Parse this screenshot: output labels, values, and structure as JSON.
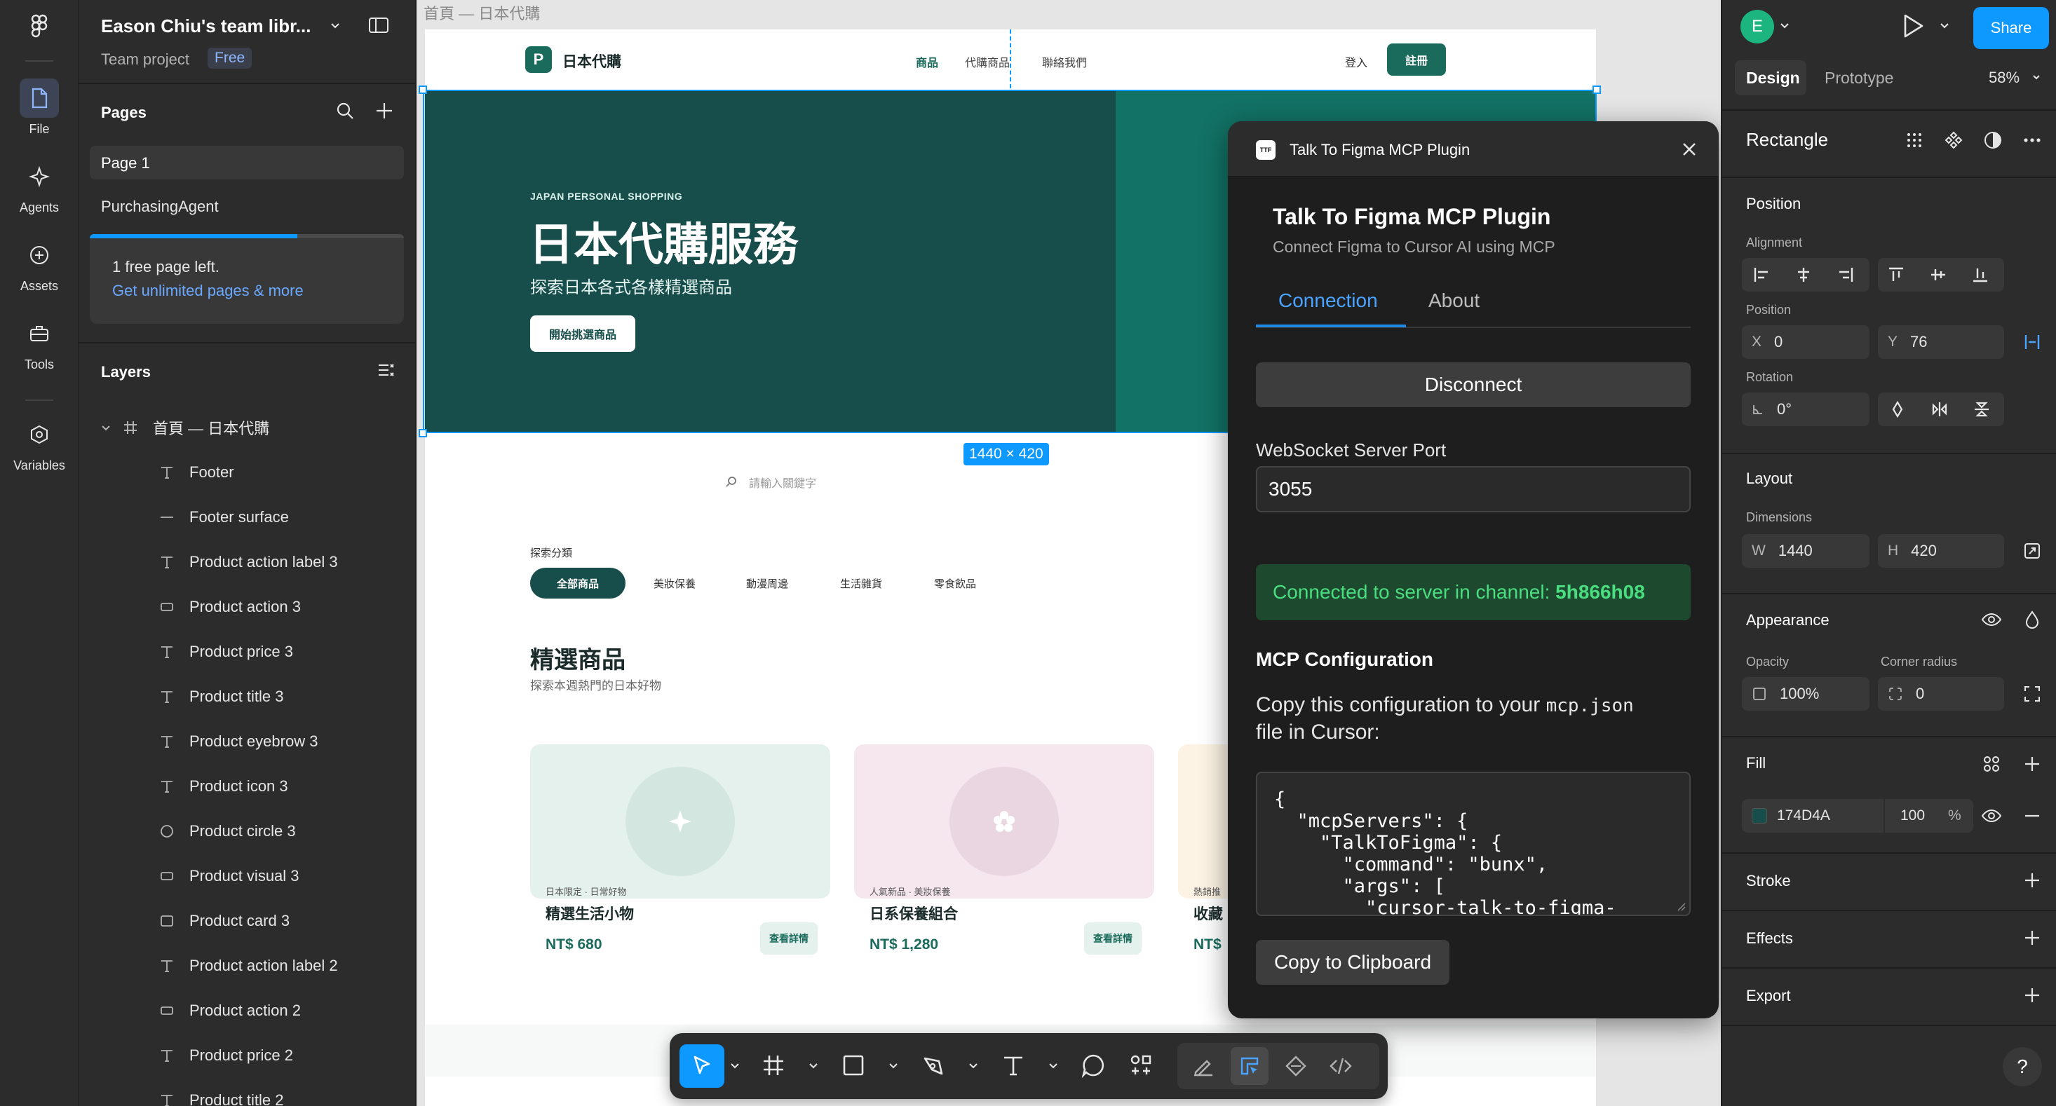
{
  "rail": {
    "items": [
      {
        "label": "File",
        "icon": "file-icon"
      },
      {
        "label": "Agents",
        "icon": "agents-sparkle-icon"
      },
      {
        "label": "Assets",
        "icon": "assets-plus-icon"
      },
      {
        "label": "Tools",
        "icon": "toolbox-icon"
      },
      {
        "label": "Variables",
        "icon": "variables-icon"
      }
    ]
  },
  "left_panel": {
    "team_name": "Eason Chiu's team libr...",
    "project_label": "Team project",
    "plan_badge": "Free",
    "pages_heading": "Pages",
    "pages": [
      "Page 1",
      "PurchasingAgent"
    ],
    "free_notice": "1 free page left.",
    "upgrade_link": "Get unlimited pages & more",
    "page_usage_fraction": 0.66,
    "layers_heading": "Layers",
    "root_frame": "首頁 — 日本代購",
    "layers": [
      {
        "name": "Footer",
        "type": "text"
      },
      {
        "name": "Footer surface",
        "type": "line"
      },
      {
        "name": "Product action label 3",
        "type": "text"
      },
      {
        "name": "Product action 3",
        "type": "rect"
      },
      {
        "name": "Product price 3",
        "type": "text"
      },
      {
        "name": "Product title 3",
        "type": "text"
      },
      {
        "name": "Product eyebrow 3",
        "type": "text"
      },
      {
        "name": "Product icon 3",
        "type": "text"
      },
      {
        "name": "Product circle 3",
        "type": "ellipse"
      },
      {
        "name": "Product visual 3",
        "type": "rect"
      },
      {
        "name": "Product card 3",
        "type": "frame"
      },
      {
        "name": "Product action label 2",
        "type": "text"
      },
      {
        "name": "Product action 2",
        "type": "rect"
      },
      {
        "name": "Product price 2",
        "type": "text"
      },
      {
        "name": "Product title 2",
        "type": "text"
      }
    ]
  },
  "canvas": {
    "frame_label": "首頁 — 日本代購",
    "selection_size": "1440 × 420",
    "site": {
      "logo_letter": "P",
      "brand": "日本代購",
      "nav": [
        "商品",
        "代購商品",
        "聯絡我們"
      ],
      "login": "登入",
      "signup": "註冊",
      "hero_eyebrow": "JAPAN PERSONAL SHOPPING",
      "hero_title": "日本代購服務",
      "hero_subtitle": "探索日本各式各樣精選商品",
      "hero_cta": "開始挑選商品",
      "search_placeholder": "請輸入關鍵字",
      "category_heading": "探索分類",
      "categories": [
        "全部商品",
        "美妝保養",
        "動漫周邊",
        "生活雜貨",
        "零食飲品"
      ],
      "featured_title": "精選商品",
      "featured_subtitle": "探索本週熱門的日本好物",
      "products": [
        {
          "eyebrow": "日本限定 · 日常好物",
          "title": "精選生活小物",
          "price": "NT$ 680",
          "action": "查看詳情"
        },
        {
          "eyebrow": "人氣新品 · 美妝保養",
          "title": "日系保養組合",
          "price": "NT$ 1,280",
          "action": "查看詳情"
        },
        {
          "eyebrow": "熱銷推",
          "title": "收藏",
          "price": "NT$"
        }
      ]
    }
  },
  "plugin": {
    "window_title": "Talk To Figma MCP Plugin",
    "logo_text": "TTF",
    "heading": "Talk To Figma MCP Plugin",
    "subheading": "Connect Figma to Cursor AI using MCP",
    "tabs": [
      "Connection",
      "About"
    ],
    "disconnect_label": "Disconnect",
    "port_label": "WebSocket Server Port",
    "port_value": "3055",
    "status_prefix": "Connected to server in channel: ",
    "channel": "5h866h08",
    "config_heading": "MCP Configuration",
    "config_text_1": "Copy this configuration to your ",
    "config_file": "mcp.json",
    "config_text_2": "file in Cursor:",
    "config_json": "{\n  \"mcpServers\": {\n    \"TalkToFigma\": {\n      \"command\": \"bunx\",\n      \"args\": [\n        \"cursor-talk-to-figma-",
    "copy_label": "Copy to Clipboard"
  },
  "right_panel": {
    "avatar_letter": "E",
    "share_label": "Share",
    "tabs": [
      "Design",
      "Prototype"
    ],
    "zoom": "58%",
    "selection_type": "Rectangle",
    "position_heading": "Position",
    "alignment_label": "Alignment",
    "position_label": "Position",
    "x_label": "X",
    "x_value": "0",
    "y_label": "Y",
    "y_value": "76",
    "rotation_label": "Rotation",
    "rotation_value": "0°",
    "layout_heading": "Layout",
    "dimensions_label": "Dimensions",
    "w_label": "W",
    "w_value": "1440",
    "h_label": "H",
    "h_value": "420",
    "appearance_heading": "Appearance",
    "opacity_label": "Opacity",
    "opacity_value": "100%",
    "radius_label": "Corner radius",
    "radius_value": "0",
    "fill_heading": "Fill",
    "fill_hex": "174D4A",
    "fill_opacity": "100",
    "fill_percent": "%",
    "stroke_heading": "Stroke",
    "effects_heading": "Effects",
    "export_heading": "Export",
    "help_label": "?"
  },
  "colors": {
    "accent": "#0d99ff",
    "hero_dark": "#174d4a",
    "hero_teal": "#127265",
    "brand_green": "#1a6b5c",
    "success_green": "#4ade80"
  }
}
